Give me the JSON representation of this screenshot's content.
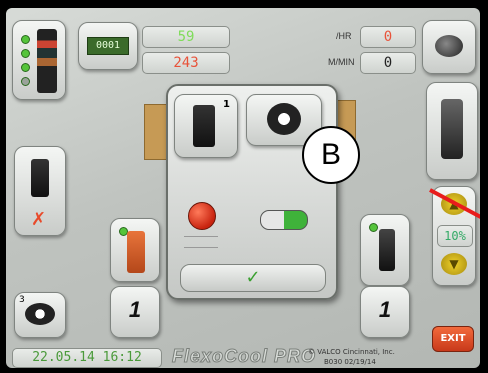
{
  "counters": {
    "badge": "0001",
    "value_top": "59",
    "value_bottom": "243",
    "rate_top_label": "/HR",
    "rate_top_value": "0",
    "rate_bottom_label": "M/MIN",
    "rate_bottom_value": "0"
  },
  "dialog": {
    "station_number": "1",
    "overlay_letter": "B"
  },
  "left_stations": {
    "station_count": "1",
    "bottom_tool_number": "3"
  },
  "right_stations": {
    "station_count": "1",
    "speed_percent": "10%"
  },
  "footer": {
    "datetime": "22.05.14 16:12",
    "brand": "FlexoCool PRO",
    "vendor": "© VALCO Cincinnati, Inc.",
    "version": "B030 02/19/14",
    "exit_label": "EXIT"
  },
  "colors": {
    "green_text": "#7fdc5a",
    "red_text": "#e8533a",
    "exit_red": "#e24a24",
    "speed_yellow": "#f0d22a",
    "annotation_red": "#e81c1c"
  }
}
